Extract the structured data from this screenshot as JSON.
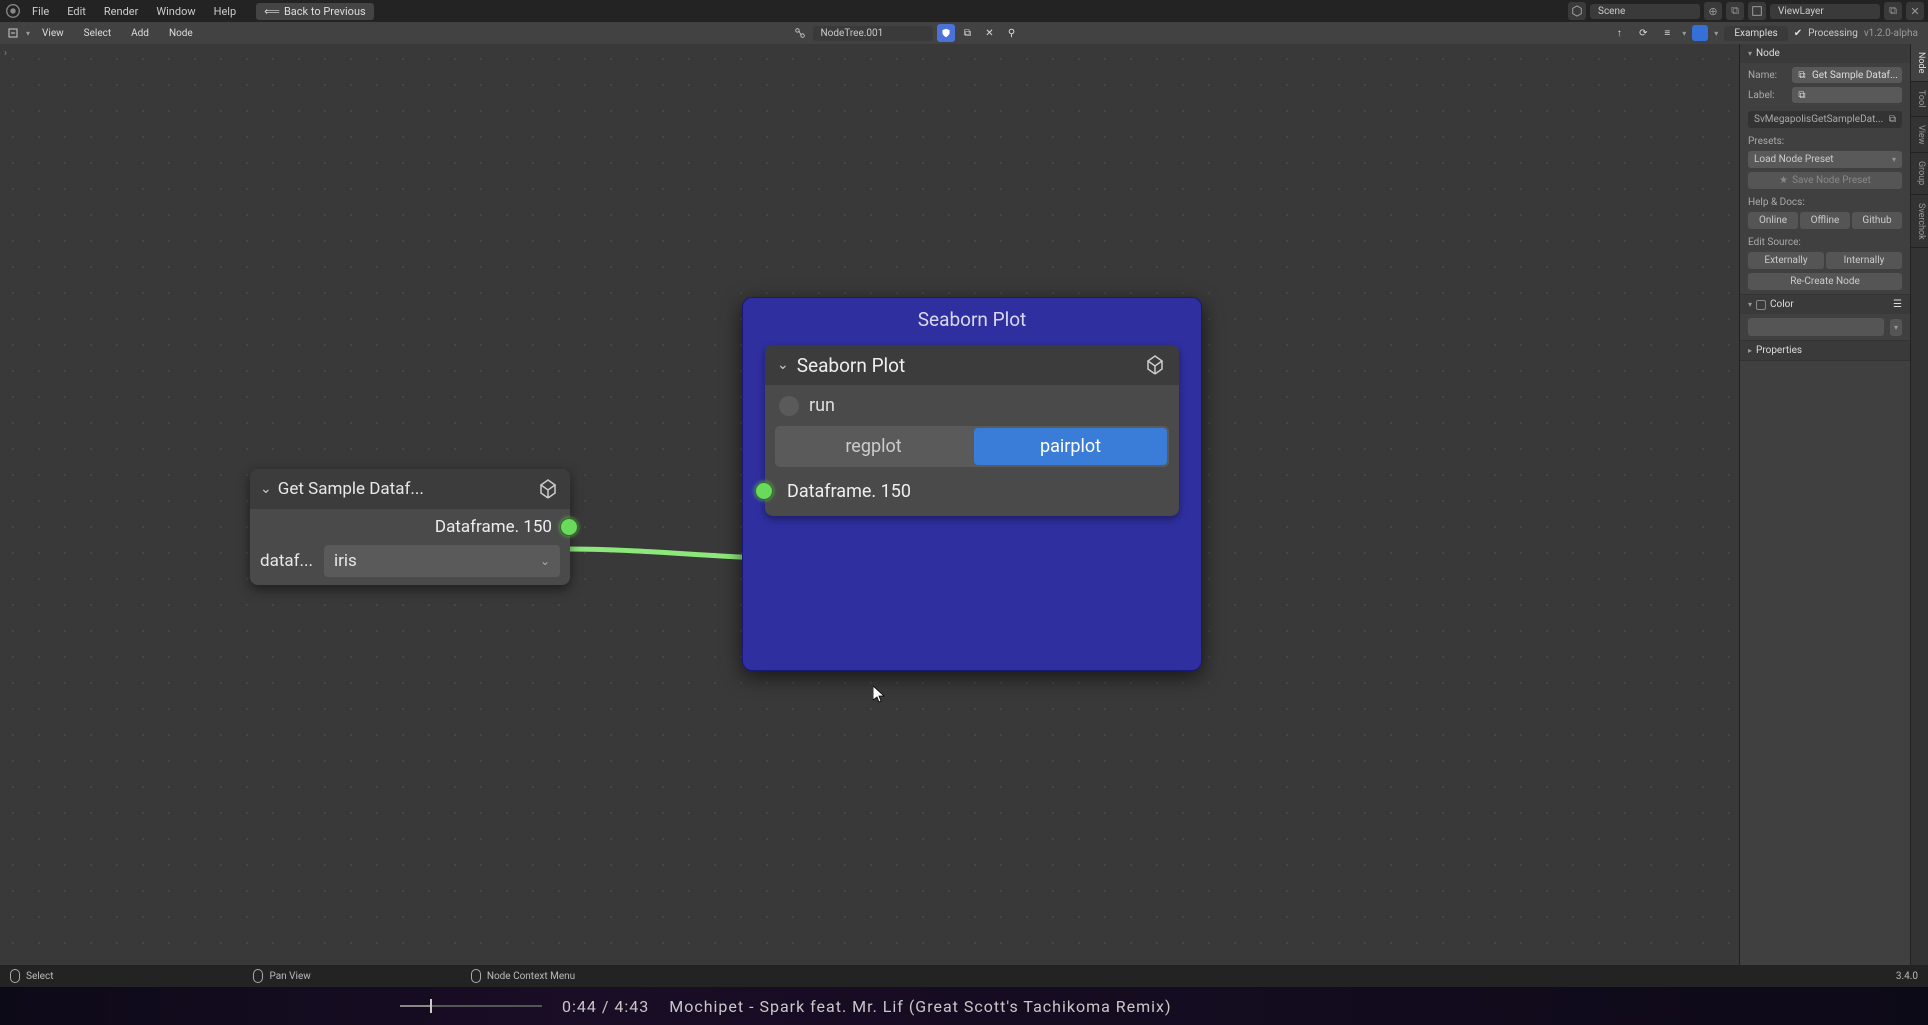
{
  "topbar": {
    "menus": [
      "File",
      "Edit",
      "Render",
      "Window",
      "Help"
    ],
    "back_label": "Back to Previous",
    "scene_label": "Scene",
    "viewlayer_label": "ViewLayer"
  },
  "header2": {
    "menus": [
      "View",
      "Select",
      "Add",
      "Node"
    ],
    "nodetree_label": "NodeTree.001",
    "examples_label": "Examples",
    "processing_label": "Processing",
    "version_label": "v1.2.0-alpha"
  },
  "sidepanel": {
    "tabs": [
      "Node",
      "Tool",
      "View",
      "Group",
      "Sverchok"
    ],
    "node_section": "Node",
    "name_label": "Name:",
    "name_value": "Get Sample Dataf...",
    "label_label": "Label:",
    "label_value": "",
    "id_value": "SvMegapolisGetSampleDat...",
    "presets_label": "Presets:",
    "load_preset": "Load Node Preset",
    "save_preset": "Save Node Preset",
    "help_label": "Help & Docs:",
    "help_btns": [
      "Online",
      "Offline",
      "Github"
    ],
    "edit_src_label": "Edit Source:",
    "edit_btns": [
      "Externally",
      "Internally"
    ],
    "recreate_btn": "Re-Create Node",
    "color_section": "Color",
    "properties_section": "Properties"
  },
  "node1": {
    "title": "Get Sample Dataf...",
    "output_label": "Dataframe. 150",
    "prop_label": "dataf...",
    "prop_value": "iris"
  },
  "node2": {
    "frame_title": "Seaborn Plot",
    "title": "Seaborn Plot",
    "run_label": "run",
    "tab1": "regplot",
    "tab2": "pairplot",
    "input_label": "Dataframe. 150"
  },
  "statusbar": {
    "select": "Select",
    "pan": "Pan View",
    "ctx": "Node Context Menu",
    "version": "3.4.0"
  },
  "music": {
    "time": "0:44 / 4:43",
    "track": "Mochipet - Spark feat. Mr. Lif (Great Scott's Tachikoma Remix)"
  }
}
